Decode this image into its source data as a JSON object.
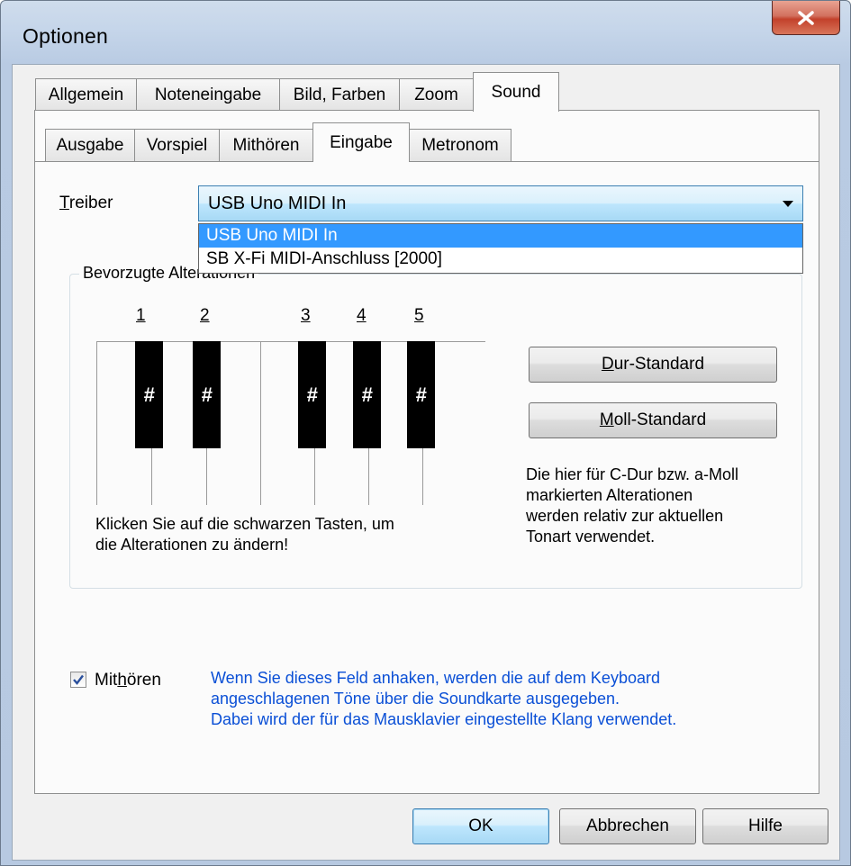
{
  "window": {
    "title": "Optionen"
  },
  "main_tabs": [
    {
      "label": "Allgemein"
    },
    {
      "label": "Noteneingabe"
    },
    {
      "label": "Bild, Farben"
    },
    {
      "label": "Zoom"
    },
    {
      "label": "Sound"
    }
  ],
  "sub_tabs": [
    {
      "label": "Ausgabe"
    },
    {
      "label": "Vorspiel"
    },
    {
      "label": "Mithören"
    },
    {
      "label": "Eingabe"
    },
    {
      "label": "Metronom"
    }
  ],
  "treiber": {
    "label_first": "T",
    "label_rest": "reiber",
    "selected": "USB Uno MIDI  In",
    "options": [
      "USB Uno MIDI  In",
      "SB X-Fi MIDI-Anschluss [2000]"
    ]
  },
  "group": {
    "title": "Bevorzugte Alterationen",
    "key_numbers": [
      "1",
      "2",
      "3",
      "4",
      "5"
    ],
    "key_symbol": "#",
    "instruction_line1": "Klicken Sie auf die schwarzen Tasten, um",
    "instruction_line2": "die Alterationen zu ändern!",
    "dur_button": {
      "first": "D",
      "rest": "ur-Standard"
    },
    "moll_button": {
      "first": "M",
      "rest": "oll-Standard"
    },
    "note_lines": [
      "Die hier für C-Dur bzw. a-Moll",
      "markierten Alterationen",
      "werden relativ zur aktuellen",
      "Tonart verwendet."
    ]
  },
  "mithoeren": {
    "checked": true,
    "label_pre": "Mit",
    "label_ul": "h",
    "label_post": "ören",
    "info_lines": [
      "Wenn Sie dieses Feld anhaken, werden die auf dem Keyboard",
      "angeschlagenen Töne über die Soundkarte ausgegeben.",
      "Dabei wird der für das Mausklavier eingestellte Klang verwendet."
    ]
  },
  "buttons": {
    "ok": "OK",
    "cancel": "Abbrechen",
    "help": "Hilfe"
  },
  "colors": {
    "accent_blue": "#0a4fd6",
    "selection": "#3399ff",
    "close_red": "#c3412b"
  }
}
